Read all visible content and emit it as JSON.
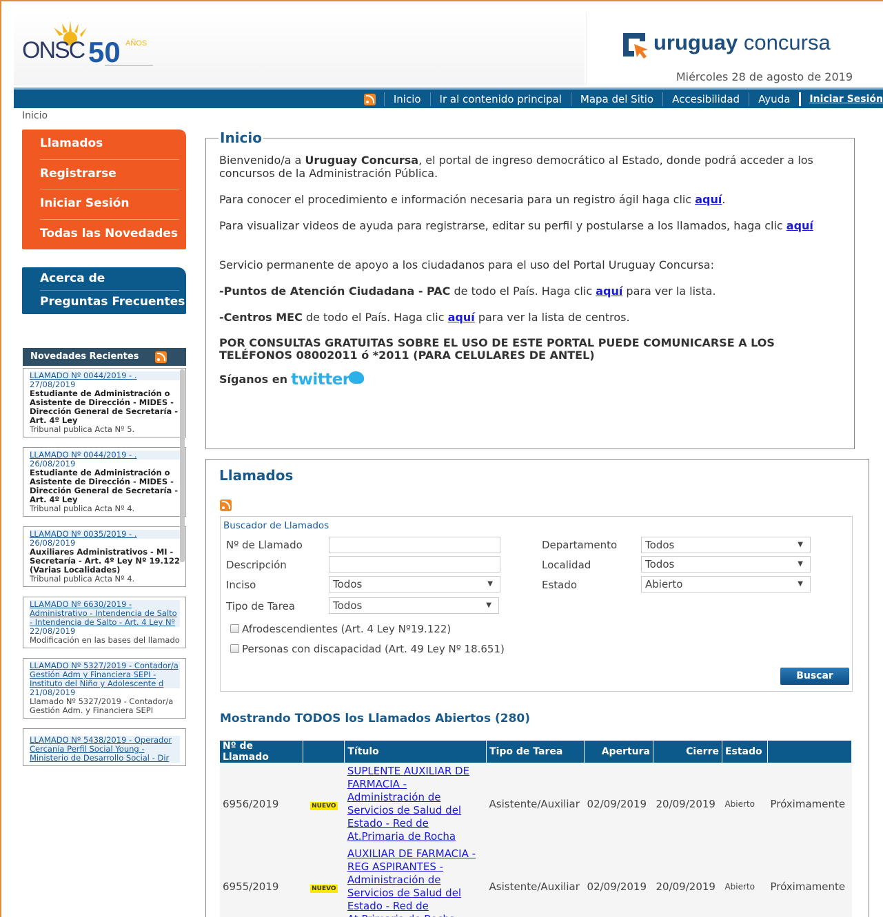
{
  "header": {
    "onsc_logo": "ONSC",
    "onsc_anniversary": "50",
    "onsc_anniversary_word": "AÑOS",
    "site_brand_bold": "uruguay",
    "site_brand_light": " concursa",
    "date": "Miércoles 28 de agosto de 2019"
  },
  "nav": {
    "items": [
      "Inicio",
      "Ir al contenido principal",
      "Mapa del Sitio",
      "Accesibilidad",
      "Ayuda"
    ],
    "login": "Iniciar Sesión"
  },
  "breadcrumb": "Inicio",
  "menu_orange": [
    "Llamados",
    "Registrarse",
    "Iniciar Sesión",
    "Todas las Novedades"
  ],
  "menu_blue": [
    "Acerca de",
    "Preguntas Frecuentes"
  ],
  "novedades": {
    "title": "Novedades Recientes",
    "items": [
      {
        "link": "LLAMADO Nº 0044/2019 - .",
        "date": "27/08/2019",
        "title": "Estudiante de Administración o Asistente de Dirección - MIDES - Dirección General de Secretaría - Art. 4º Ley",
        "sub": "Tribunal publica Acta Nº 5."
      },
      {
        "link": "LLAMADO Nº 0044/2019 - .",
        "date": "26/08/2019",
        "title": "Estudiante de Administración o Asistente de Dirección - MIDES - Dirección General de Secretaría - Art. 4º Ley",
        "sub": "Tribunal publica Acta Nº 4."
      },
      {
        "link": "LLAMADO Nº 0035/2019 - .",
        "date": "26/08/2019",
        "title": "Auxiliares Administrativos - MI - Secretaría - Art. 4º Ley Nº 19.122 (Varias Localidades)",
        "sub": "Tribunal publica Acta Nº 4."
      },
      {
        "link": "LLAMADO Nº 6630/2019 - Administrativo - Intendencia de Salto - Intendencia de Salto - Art. 4 Ley Nº",
        "date": "22/08/2019",
        "title": "",
        "sub": "Modificación en las bases del llamado"
      },
      {
        "link": "LLAMADO Nº 5327/2019 - Contador/a Gestión Adm y Financiera SEPI - Instituto del Niño y Adolescente d",
        "date": "21/08/2019",
        "title": "",
        "sub": "Llamado Nº 5327/2019 - Contador/a Gestión Adm. y Financiera SEPI"
      },
      {
        "link": "LLAMADO Nº 5438/2019 - Operador Cercanía Perfil Social Young - Ministerio de Desarrollo Social - Dir",
        "date": "",
        "title": "",
        "sub": ""
      }
    ]
  },
  "inicio": {
    "legend": "Inicio",
    "p1_pre": "Bienvenido/a a ",
    "p1_bold": "Uruguay Concursa",
    "p1_post": ", el portal de ingreso democrático al Estado, donde podrá acceder a los concursos de la Administración Pública.",
    "p2_pre": "Para conocer el procedimiento e información necesaria para un registro ágil haga clic ",
    "p2_link": "aquí",
    "p2_post": ".",
    "p3_pre": "Para visualizar videos de ayuda para registrarse, editar su perfil y postularse a los llamados, haga clic ",
    "p3_link": "aquí",
    "p4": "Servicio permanente de apoyo a los ciudadanos para el uso del Portal Uruguay Concursa:",
    "p5_bold": "-Puntos de Atención Ciudadana - PAC",
    "p5_pre": " de todo el País. Haga clic ",
    "p5_link": "aquí",
    "p5_post": " para ver la lista.",
    "p6_bold": "-Centros MEC",
    "p6_pre": " de todo el País. Haga clic ",
    "p6_link": "aquí",
    "p6_post": " para ver la lista de centros.",
    "p7": "POR CONSULTAS GRATUITAS SOBRE EL USO DE ESTE PORTAL PUEDE COMUNICARSE A LOS TELÉFONOS 08002011 ó *2011 (PARA CELULARES DE ANTEL)",
    "follow": "Síganos en",
    "twitter": "twitter"
  },
  "llamados": {
    "title": "Llamados",
    "buscador_label": "Buscador de Llamados",
    "fields": {
      "numero": "Nº de Llamado",
      "descripcion": "Descripción",
      "inciso": "Inciso",
      "inciso_value": "Todos",
      "tipo": "Tipo de Tarea",
      "tipo_value": "Todos",
      "departamento": "Departamento",
      "departamento_value": "Todos",
      "localidad": "Localidad",
      "localidad_value": "Todos",
      "estado": "Estado",
      "estado_value": "Abierto"
    },
    "check1": "Afrodescendientes (Art. 4 Ley Nº19.122)",
    "check2": "Personas con discapacidad (Art. 49 Ley Nº 18.651)",
    "search_button": "Buscar",
    "showing": "Mostrando TODOS los Llamados Abiertos (280)",
    "columns": [
      "Nº de Llamado",
      "",
      "Título",
      "Tipo de Tarea",
      "Apertura",
      "Cierre",
      "Estado",
      ""
    ],
    "rows": [
      {
        "numero": "6956/2019",
        "badge": "NUEVO",
        "titulo": "SUPLENTE AUXILIAR DE FARMACIA - Administración de Servicios de Salud del Estado - Red de At.Primaria de Rocha",
        "tipo": "Asistente/Auxiliar",
        "apertura": "02/09/2019",
        "cierre": "20/09/2019",
        "estado": "Abierto",
        "extra": "Próximamente"
      },
      {
        "numero": "6955/2019",
        "badge": "NUEVO",
        "titulo": "AUXILIAR DE FARMACIA - REG ASPIRANTES - Administración de Servicios de Salud del Estado - Red de At.Primaria de Rocha",
        "tipo": "Asistente/Auxiliar",
        "apertura": "02/09/2019",
        "cierre": "20/09/2019",
        "estado": "Abierto",
        "extra": "Próximamente"
      }
    ]
  }
}
